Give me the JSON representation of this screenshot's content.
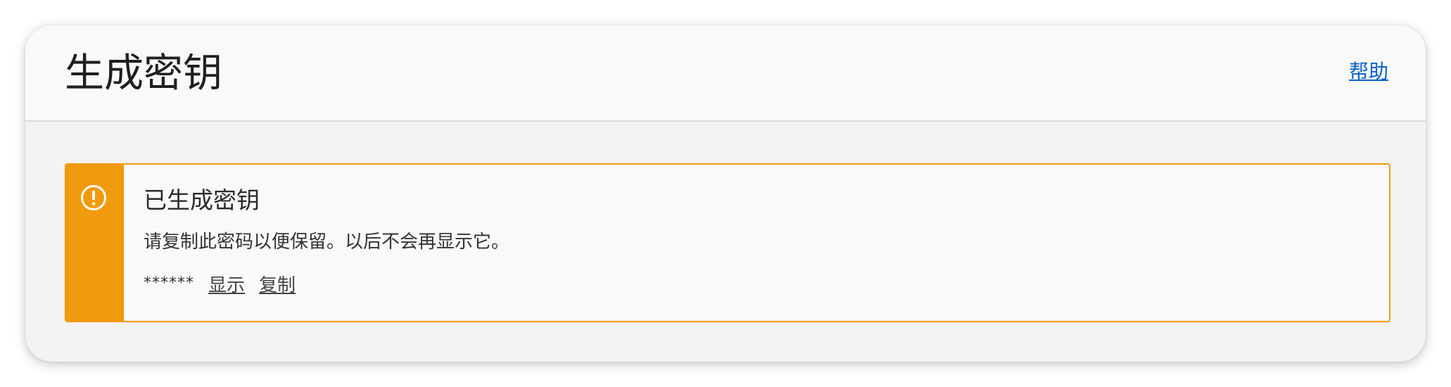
{
  "header": {
    "title": "生成密钥",
    "help_label": "帮助"
  },
  "alert": {
    "icon": "exclamation-circle-icon",
    "accent_color": "#f09a0d",
    "title": "已生成密钥",
    "message": "请复制此密码以便保留。以后不会再显示它。",
    "secret_mask": "******",
    "show_label": "显示",
    "copy_label": "复制"
  },
  "colors": {
    "link": "#0b62c6",
    "warning": "#f09a0d"
  }
}
